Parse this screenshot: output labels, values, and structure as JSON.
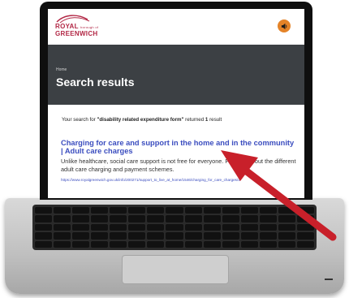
{
  "header": {
    "logo_line1": "ROYAL",
    "logo_small": "borough of",
    "logo_line2": "GREENWICH",
    "speaker_icon": "speaker-icon"
  },
  "hero": {
    "breadcrumb": "Home",
    "title": "Search results"
  },
  "results": {
    "summary_prefix": "Your search for ",
    "query": "\"disability related expenditure form\"",
    "summary_mid": " returned ",
    "count": "1",
    "summary_suffix": " result",
    "items": [
      {
        "title": "Charging for care and support in the home and in the community | Adult care charges",
        "snippet": "Unlike healthcare, social care support is not free for everyone. Find out about the different adult care charging and payment schemes.",
        "url": "https://www.royalgreenwich.gov.uk/info/200271/support_to_live_at_home/1546/charging_for_care_charges/4"
      }
    ]
  },
  "colors": {
    "brand_red": "#b22745",
    "hero_bg": "#3c4044",
    "link": "#3b4dbf",
    "speaker_bg": "#e48328",
    "arrow": "#c8202a"
  }
}
